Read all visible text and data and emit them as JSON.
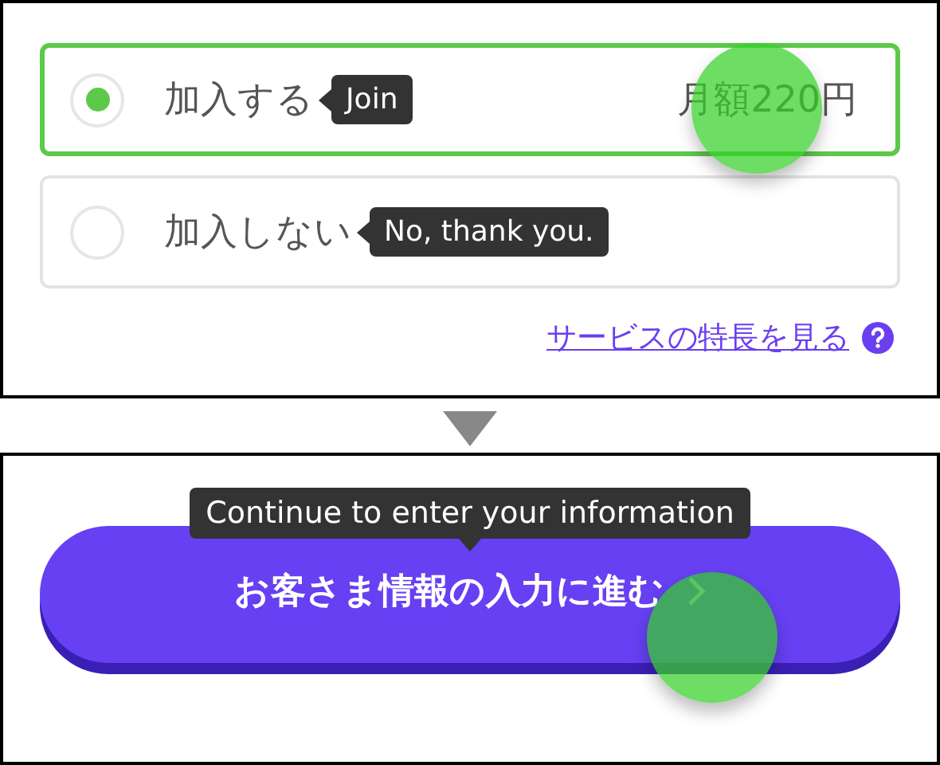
{
  "options": [
    {
      "label": "加入する",
      "hint": "Join",
      "price": "月額220円",
      "selected": true,
      "tapped": true
    },
    {
      "label": "加入しない",
      "hint": "No, thank you.",
      "selected": false,
      "tapped": false
    }
  ],
  "link": {
    "label": "サービスの特長を見る"
  },
  "button": {
    "label": "お客さま情報の入力に進む",
    "hint": "Continue to enter your information",
    "tapped": true
  }
}
